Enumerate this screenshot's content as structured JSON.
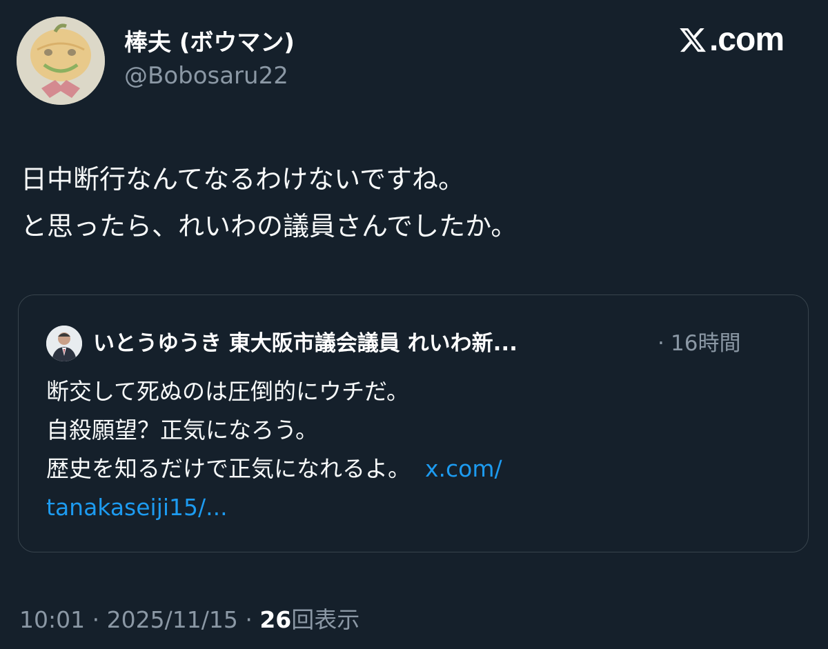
{
  "author": {
    "display_name": "棒夫 (ボウマン)",
    "handle": "@Bobosaru22",
    "avatar_icon": "pumpkin-face-avatar"
  },
  "brand": {
    "logo_icon": "x-logo-icon",
    "text": ".com"
  },
  "tweet": {
    "lines": [
      "日中断行なんてなるわけないですね。",
      "と思ったら、れいわの議員さんでしたか。"
    ]
  },
  "quote": {
    "author_name": "いとうゆうき 東大阪市議会議員 れいわ新...",
    "separator": "·",
    "time": "16時間",
    "lines": [
      "断交して死ぬのは圧倒的にウチだ。",
      "自殺願望？正気になろう。",
      "歴史を知るだけで正気になれるよ。"
    ],
    "link_part1": "x.com/",
    "link_part2": "tanakaseiji15/...",
    "avatar_icon": "person-photo-avatar"
  },
  "meta": {
    "time": "10:01",
    "sep1": "·",
    "date": "2025/11/15",
    "sep2": "·",
    "views_count": "26",
    "views_label": "回表示"
  },
  "colors": {
    "background": "#15202b",
    "text": "#e7e9ea",
    "secondary": "#8b98a5",
    "link": "#1d9bf0",
    "border": "#38444d"
  }
}
